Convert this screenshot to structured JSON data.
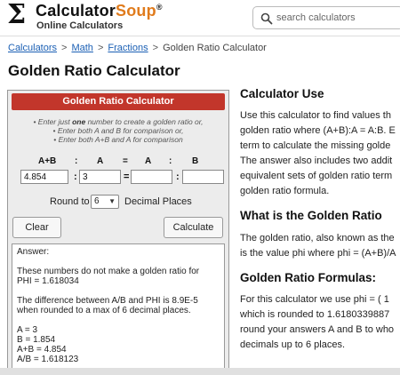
{
  "header": {
    "logo_symbol": "Σ",
    "logo_main": "Calculator",
    "logo_accent": "Soup",
    "logo_mark": "®",
    "logo_sub": "Online Calculators",
    "search_placeholder": "search calculators"
  },
  "breadcrumb": {
    "items": [
      "Calculators",
      "Math",
      "Fractions"
    ],
    "current": "Golden Ratio Calculator",
    "separator": ">"
  },
  "page_title": "Golden Ratio Calculator",
  "calculator": {
    "title": "Golden Ratio Calculator",
    "instructions": {
      "line1_pre": "• Enter just ",
      "line1_bold": "one",
      "line1_post": " number to create a golden ratio or,",
      "line2": "• Enter both A and B for comparison or,",
      "line3": "• Enter both A+B and A for comparison"
    },
    "labels": {
      "apb": "A+B",
      "colon": ":",
      "a1": "A",
      "equals": "=",
      "a2": "A",
      "b": "B"
    },
    "fields": {
      "apb_value": "4.854",
      "a_value": "3",
      "a2_value": "",
      "b_value": ""
    },
    "round_label": "Round to",
    "round_value": "6",
    "round_suffix": "Decimal Places",
    "clear_label": "Clear",
    "calculate_label": "Calculate",
    "answer": {
      "heading": "Answer:",
      "p1_l1": "These numbers do not make a golden ratio for",
      "p1_l2": "PHI = 1.618034",
      "p2_l1": "The difference between A/B and PHI is 8.9E-5",
      "p2_l2": "when rounded to a max of 6 decimal places.",
      "r1": "A = 3",
      "r2": "B = 1.854",
      "r3": "A+B = 4.854",
      "r4": "A/B = 1.618123"
    }
  },
  "article": {
    "h_use": "Calculator Use",
    "use_lines": [
      "Use this calculator to find values th",
      "golden ratio where (A+B):A = A:B. E",
      "term to calculate the missing golde",
      "The answer also includes two addit",
      "equivalent sets of golden ratio term",
      "golden ratio formula."
    ],
    "h_what": "What is the Golden Ratio",
    "what_lines": [
      "The golden ratio, also known as the",
      "is the value phi where phi = (A+B)/A"
    ],
    "h_formulas": "Golden Ratio Formulas:",
    "formula_lines": [
      "For this calculator we use phi = ( 1",
      "which is rounded to 1.6180339887",
      "round your answers A and B to who",
      "decimals up to 6 places."
    ]
  }
}
